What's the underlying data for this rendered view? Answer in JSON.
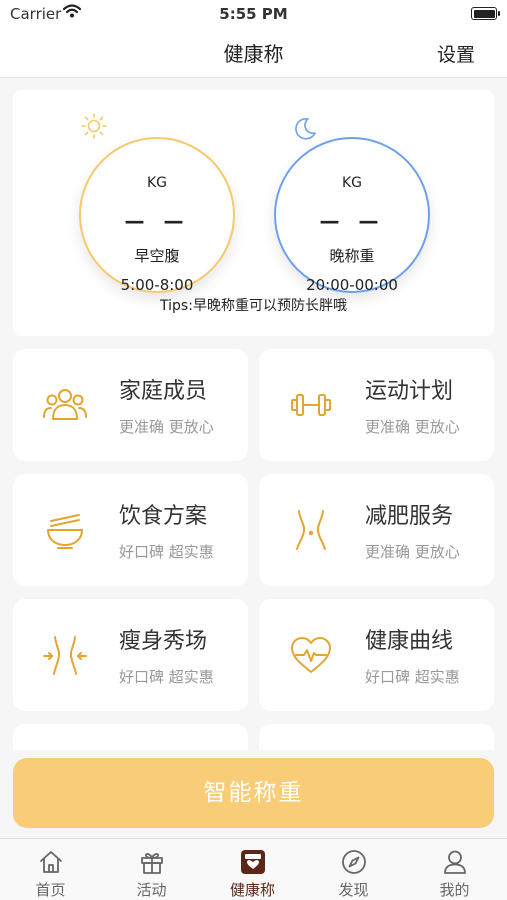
{
  "status_bar": {
    "carrier": "Carrier",
    "time": "5:55 PM"
  },
  "nav": {
    "title": "健康称",
    "settings": "设置"
  },
  "weigh_card": {
    "morning": {
      "unit": "KG",
      "value": "— —",
      "label": "早空腹",
      "range": "5:00-8:00",
      "icon": "sun-icon",
      "color": "#f7c96b"
    },
    "evening": {
      "unit": "KG",
      "value": "— —",
      "label": "晚称重",
      "range": "20:00-00:00",
      "icon": "moon-icon",
      "color": "#6ea1eb"
    },
    "tips": "Tips:早晚称重可以预防长胖哦"
  },
  "tiles": [
    {
      "title": "家庭成员",
      "subtitle": "更准确 更放心",
      "icon": "family-members-icon"
    },
    {
      "title": "运动计划",
      "subtitle": "更准确 更放心",
      "icon": "dumbbell-icon"
    },
    {
      "title": "饮食方案",
      "subtitle": "好口碑 超实惠",
      "icon": "food-bowl-icon"
    },
    {
      "title": "减肥服务",
      "subtitle": "更准确 更放心",
      "icon": "waist-icon"
    },
    {
      "title": "瘦身秀场",
      "subtitle": "好口碑 超实惠",
      "icon": "slim-waist-icon"
    },
    {
      "title": "健康曲线",
      "subtitle": "好口碑 超实惠",
      "icon": "heart-pulse-icon"
    }
  ],
  "smart_weigh_button": "智能称重",
  "tab_bar": [
    {
      "label": "首页",
      "icon": "home-icon",
      "active": false
    },
    {
      "label": "活动",
      "icon": "gift-icon",
      "active": false
    },
    {
      "label": "健康称",
      "icon": "scale-icon",
      "active": true
    },
    {
      "label": "发现",
      "icon": "compass-icon",
      "active": false
    },
    {
      "label": "我的",
      "icon": "user-icon",
      "active": false
    }
  ],
  "colors": {
    "accent": "#f9cc77",
    "icon_gold": "#e3a530",
    "active_tab": "#5a2718"
  }
}
